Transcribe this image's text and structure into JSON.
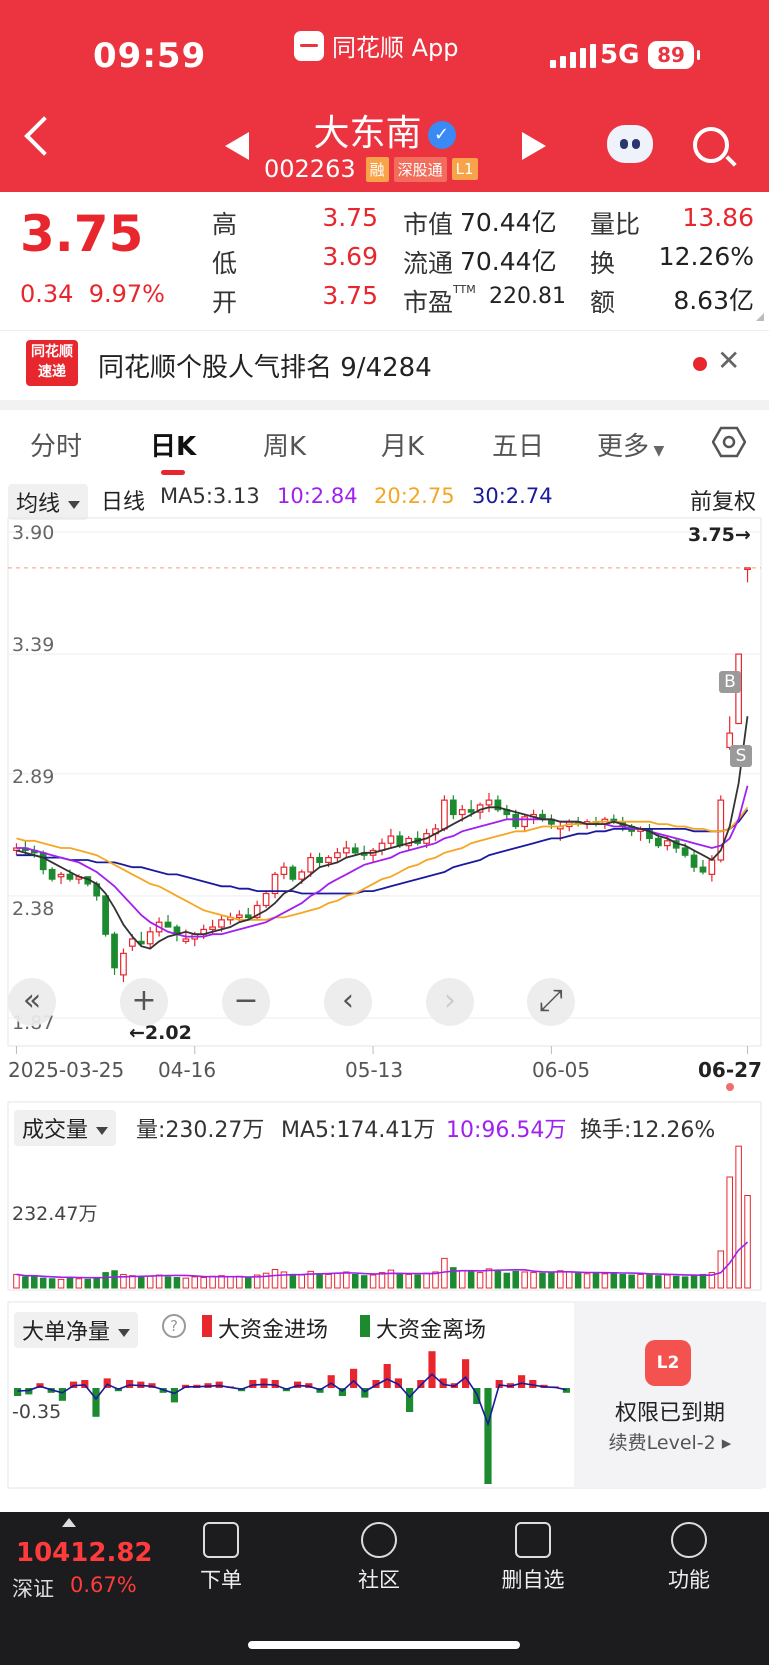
{
  "status_bar": {
    "time": "09:59",
    "app_name": "同花顺 App",
    "network": "5G",
    "battery": "89"
  },
  "stock": {
    "name": "大东南",
    "code": "002263",
    "tags": [
      "融",
      "深股通",
      "L1"
    ]
  },
  "quote": {
    "price": "3.75",
    "change": "0.34",
    "change_pct": "9.97%",
    "labels": {
      "high": "高",
      "low": "低",
      "open": "开",
      "mktcap": "市值",
      "float": "流通",
      "pe": "市盈",
      "pe_sup": "TTM",
      "vol_ratio": "量比",
      "turnover": "换",
      "amount": "额"
    },
    "values": {
      "high": "3.75",
      "low": "3.69",
      "open": "3.75",
      "mktcap": "70.44亿",
      "float": "70.44亿",
      "pe": "220.81",
      "vol_ratio": "13.86",
      "turnover": "12.26%",
      "amount": "8.63亿"
    }
  },
  "banner": {
    "logo": "同花顺\n速递",
    "text": "同花顺个股人气排名 9/4284"
  },
  "tabs": [
    "分时",
    "日K",
    "周K",
    "月K",
    "五日",
    "更多"
  ],
  "active_tab": "日K",
  "ma_row": {
    "selector": "均线",
    "period": "日线",
    "ma5": "MA5:3.13",
    "ma10": "10:2.84",
    "ma20": "20:2.75",
    "ma30": "30:2.74",
    "adjust": "前复权"
  },
  "colors": {
    "up": "#e8262e",
    "down": "#1c8a2e",
    "ma5": "#333333",
    "ma10": "#a020f0",
    "ma20": "#f5a623",
    "ma30": "#1a1a9e",
    "header": "#ec3440"
  },
  "chart_data": {
    "type": "candlestick",
    "y_ticks": [
      "3.90",
      "3.39",
      "2.89",
      "2.38",
      "1.87"
    ],
    "ylim": [
      1.87,
      3.9
    ],
    "x_ticks": [
      "2025-03-25",
      "04-16",
      "05-13",
      "06-05",
      "06-27"
    ],
    "last_price_label": "3.75→",
    "low_marker": "←2.02",
    "markers": [
      "B",
      "S"
    ],
    "candles": [
      [
        2.57,
        2.6,
        2.55,
        2.58
      ],
      [
        2.58,
        2.61,
        2.55,
        2.57
      ],
      [
        2.57,
        2.59,
        2.54,
        2.56
      ],
      [
        2.56,
        2.57,
        2.47,
        2.49
      ],
      [
        2.49,
        2.5,
        2.44,
        2.45
      ],
      [
        2.46,
        2.48,
        2.43,
        2.47
      ],
      [
        2.47,
        2.49,
        2.44,
        2.45
      ],
      [
        2.45,
        2.47,
        2.43,
        2.46
      ],
      [
        2.46,
        2.46,
        2.42,
        2.43
      ],
      [
        2.43,
        2.44,
        2.36,
        2.38
      ],
      [
        2.38,
        2.38,
        2.21,
        2.22
      ],
      [
        2.22,
        2.23,
        2.05,
        2.08
      ],
      [
        2.05,
        2.16,
        2.02,
        2.14
      ],
      [
        2.17,
        2.22,
        2.15,
        2.2
      ],
      [
        2.19,
        2.23,
        2.17,
        2.18
      ],
      [
        2.18,
        2.25,
        2.16,
        2.23
      ],
      [
        2.23,
        2.29,
        2.21,
        2.27
      ],
      [
        2.27,
        2.3,
        2.25,
        2.25
      ],
      [
        2.25,
        2.26,
        2.19,
        2.22
      ],
      [
        2.19,
        2.24,
        2.18,
        2.2
      ],
      [
        2.2,
        2.23,
        2.17,
        2.22
      ],
      [
        2.22,
        2.26,
        2.2,
        2.24
      ],
      [
        2.24,
        2.28,
        2.22,
        2.25
      ],
      [
        2.25,
        2.3,
        2.23,
        2.28
      ],
      [
        2.28,
        2.31,
        2.26,
        2.29
      ],
      [
        2.29,
        2.32,
        2.27,
        2.3
      ],
      [
        2.3,
        2.33,
        2.28,
        2.29
      ],
      [
        2.29,
        2.36,
        2.28,
        2.34
      ],
      [
        2.34,
        2.4,
        2.33,
        2.39
      ],
      [
        2.39,
        2.48,
        2.37,
        2.47
      ],
      [
        2.47,
        2.52,
        2.45,
        2.5
      ],
      [
        2.5,
        2.51,
        2.44,
        2.45
      ],
      [
        2.45,
        2.49,
        2.43,
        2.48
      ],
      [
        2.48,
        2.56,
        2.46,
        2.54
      ],
      [
        2.54,
        2.56,
        2.5,
        2.52
      ],
      [
        2.52,
        2.55,
        2.5,
        2.54
      ],
      [
        2.54,
        2.58,
        2.52,
        2.56
      ],
      [
        2.56,
        2.61,
        2.54,
        2.58
      ],
      [
        2.58,
        2.6,
        2.55,
        2.56
      ],
      [
        2.56,
        2.59,
        2.53,
        2.55
      ],
      [
        2.55,
        2.58,
        2.52,
        2.57
      ],
      [
        2.57,
        2.62,
        2.55,
        2.6
      ],
      [
        2.6,
        2.66,
        2.58,
        2.63
      ],
      [
        2.63,
        2.65,
        2.58,
        2.59
      ],
      [
        2.59,
        2.63,
        2.57,
        2.62
      ],
      [
        2.62,
        2.65,
        2.59,
        2.6
      ],
      [
        2.6,
        2.66,
        2.58,
        2.64
      ],
      [
        2.64,
        2.68,
        2.61,
        2.66
      ],
      [
        2.66,
        2.8,
        2.65,
        2.78
      ],
      [
        2.78,
        2.8,
        2.7,
        2.72
      ],
      [
        2.72,
        2.76,
        2.69,
        2.74
      ],
      [
        2.74,
        2.78,
        2.71,
        2.73
      ],
      [
        2.73,
        2.77,
        2.7,
        2.76
      ],
      [
        2.76,
        2.81,
        2.73,
        2.78
      ],
      [
        2.78,
        2.8,
        2.73,
        2.74
      ],
      [
        2.74,
        2.76,
        2.7,
        2.72
      ],
      [
        2.72,
        2.74,
        2.66,
        2.67
      ],
      [
        2.67,
        2.72,
        2.65,
        2.71
      ],
      [
        2.71,
        2.74,
        2.68,
        2.72
      ],
      [
        2.72,
        2.74,
        2.69,
        2.7
      ],
      [
        2.7,
        2.72,
        2.66,
        2.68
      ],
      [
        2.66,
        2.69,
        2.61,
        2.67
      ],
      [
        2.67,
        2.7,
        2.65,
        2.69
      ],
      [
        2.69,
        2.71,
        2.67,
        2.68
      ],
      [
        2.68,
        2.7,
        2.66,
        2.69
      ],
      [
        2.69,
        2.71,
        2.67,
        2.68
      ],
      [
        2.68,
        2.71,
        2.66,
        2.7
      ],
      [
        2.7,
        2.72,
        2.68,
        2.69
      ],
      [
        2.69,
        2.71,
        2.65,
        2.67
      ],
      [
        2.67,
        2.68,
        2.63,
        2.65
      ],
      [
        2.65,
        2.67,
        2.61,
        2.66
      ],
      [
        2.66,
        2.68,
        2.6,
        2.62
      ],
      [
        2.62,
        2.64,
        2.58,
        2.59
      ],
      [
        2.59,
        2.63,
        2.57,
        2.61
      ],
      [
        2.61,
        2.62,
        2.56,
        2.58
      ],
      [
        2.58,
        2.6,
        2.54,
        2.55
      ],
      [
        2.55,
        2.57,
        2.48,
        2.5
      ],
      [
        2.5,
        2.53,
        2.47,
        2.48
      ],
      [
        2.47,
        2.55,
        2.44,
        2.53
      ],
      [
        2.53,
        2.8,
        2.52,
        2.78
      ],
      [
        3.0,
        3.13,
        2.99,
        3.06
      ],
      [
        3.1,
        3.39,
        3.1,
        3.39
      ],
      [
        3.75,
        3.75,
        3.69,
        3.75
      ]
    ],
    "ma5": [
      2.57,
      2.56,
      2.55,
      2.54,
      2.52,
      2.5,
      2.48,
      2.46,
      2.45,
      2.43,
      2.39,
      2.33,
      2.26,
      2.21,
      2.17,
      2.16,
      2.19,
      2.21,
      2.22,
      2.23,
      2.22,
      2.22,
      2.23,
      2.24,
      2.25,
      2.27,
      2.28,
      2.3,
      2.32,
      2.35,
      2.39,
      2.41,
      2.44,
      2.47,
      2.5,
      2.51,
      2.52,
      2.54,
      2.55,
      2.56,
      2.56,
      2.57,
      2.58,
      2.59,
      2.6,
      2.61,
      2.62,
      2.64,
      2.66,
      2.68,
      2.7,
      2.72,
      2.74,
      2.75,
      2.75,
      2.74,
      2.73,
      2.72,
      2.71,
      2.7,
      2.7,
      2.69,
      2.69,
      2.69,
      2.68,
      2.68,
      2.68,
      2.69,
      2.68,
      2.67,
      2.66,
      2.65,
      2.63,
      2.62,
      2.6,
      2.59,
      2.57,
      2.55,
      2.53,
      2.57,
      2.67,
      2.85,
      3.13
    ],
    "ma10": [
      2.58,
      2.58,
      2.57,
      2.56,
      2.55,
      2.54,
      2.53,
      2.52,
      2.5,
      2.48,
      2.45,
      2.42,
      2.38,
      2.34,
      2.3,
      2.27,
      2.25,
      2.23,
      2.22,
      2.21,
      2.21,
      2.21,
      2.22,
      2.22,
      2.23,
      2.24,
      2.25,
      2.26,
      2.27,
      2.29,
      2.31,
      2.33,
      2.35,
      2.38,
      2.4,
      2.43,
      2.45,
      2.47,
      2.49,
      2.51,
      2.52,
      2.53,
      2.54,
      2.56,
      2.57,
      2.58,
      2.59,
      2.6,
      2.62,
      2.63,
      2.65,
      2.66,
      2.67,
      2.68,
      2.69,
      2.7,
      2.7,
      2.7,
      2.7,
      2.7,
      2.7,
      2.69,
      2.69,
      2.69,
      2.68,
      2.68,
      2.68,
      2.67,
      2.67,
      2.66,
      2.66,
      2.65,
      2.64,
      2.63,
      2.62,
      2.61,
      2.6,
      2.59,
      2.58,
      2.59,
      2.62,
      2.7,
      2.84
    ],
    "ma20": [
      2.62,
      2.61,
      2.61,
      2.6,
      2.59,
      2.58,
      2.58,
      2.57,
      2.56,
      2.55,
      2.53,
      2.51,
      2.49,
      2.47,
      2.45,
      2.43,
      2.42,
      2.4,
      2.38,
      2.36,
      2.34,
      2.32,
      2.31,
      2.3,
      2.29,
      2.28,
      2.28,
      2.28,
      2.28,
      2.29,
      2.29,
      2.3,
      2.31,
      2.32,
      2.33,
      2.35,
      2.36,
      2.38,
      2.39,
      2.41,
      2.43,
      2.45,
      2.46,
      2.48,
      2.5,
      2.51,
      2.53,
      2.54,
      2.56,
      2.57,
      2.58,
      2.6,
      2.61,
      2.62,
      2.63,
      2.64,
      2.65,
      2.65,
      2.66,
      2.67,
      2.67,
      2.67,
      2.68,
      2.68,
      2.68,
      2.69,
      2.69,
      2.69,
      2.69,
      2.69,
      2.69,
      2.69,
      2.68,
      2.68,
      2.67,
      2.67,
      2.66,
      2.66,
      2.65,
      2.65,
      2.66,
      2.7,
      2.75
    ],
    "ma30": [
      2.55,
      2.55,
      2.55,
      2.54,
      2.54,
      2.54,
      2.53,
      2.53,
      2.53,
      2.52,
      2.52,
      2.52,
      2.51,
      2.5,
      2.5,
      2.49,
      2.48,
      2.47,
      2.47,
      2.46,
      2.45,
      2.44,
      2.43,
      2.42,
      2.42,
      2.41,
      2.41,
      2.4,
      2.4,
      2.4,
      2.4,
      2.4,
      2.39,
      2.39,
      2.39,
      2.39,
      2.39,
      2.39,
      2.39,
      2.4,
      2.4,
      2.41,
      2.42,
      2.43,
      2.44,
      2.45,
      2.46,
      2.47,
      2.48,
      2.5,
      2.51,
      2.52,
      2.53,
      2.55,
      2.56,
      2.57,
      2.58,
      2.59,
      2.6,
      2.61,
      2.62,
      2.62,
      2.63,
      2.64,
      2.64,
      2.65,
      2.65,
      2.66,
      2.66,
      2.66,
      2.66,
      2.66,
      2.66,
      2.66,
      2.66,
      2.66,
      2.65,
      2.65,
      2.65,
      2.65,
      2.66,
      2.69,
      2.74
    ]
  },
  "chart_controls": [
    "«",
    "+",
    "−",
    "‹",
    "›",
    "⤢"
  ],
  "volume": {
    "selector": "成交量",
    "vol": "量:230.27万",
    "ma5": "MA5:174.41万",
    "ma10": "10:96.54万",
    "turnover": "换手:12.26%",
    "ref": "232.47万",
    "values": [
      22,
      18,
      20,
      16,
      15,
      14,
      16,
      15,
      14,
      17,
      25,
      28,
      22,
      20,
      18,
      19,
      21,
      18,
      17,
      16,
      18,
      17,
      19,
      20,
      18,
      19,
      17,
      21,
      24,
      30,
      26,
      22,
      21,
      27,
      23,
      22,
      24,
      26,
      22,
      20,
      21,
      25,
      29,
      24,
      22,
      21,
      24,
      26,
      48,
      33,
      28,
      26,
      25,
      31,
      27,
      24,
      27,
      26,
      25,
      24,
      25,
      28,
      26,
      24,
      23,
      24,
      23,
      25,
      22,
      21,
      22,
      21,
      20,
      21,
      19,
      18,
      20,
      22,
      25,
      60,
      180,
      230,
      150
    ]
  },
  "fund_flow": {
    "selector": "大单净量",
    "legend_in": "大资金进场",
    "legend_out": "大资金离场",
    "ref": "-0.35",
    "values": [
      -0.05,
      -0.04,
      0.03,
      -0.03,
      -0.08,
      0.04,
      0.05,
      -0.18,
      0.06,
      -0.02,
      0.05,
      0.04,
      0.03,
      -0.03,
      -0.09,
      0.02,
      0.02,
      0.03,
      0.04,
      0.01,
      -0.02,
      0.05,
      0.06,
      0.05,
      -0.02,
      0.04,
      0.03,
      -0.03,
      0.08,
      -0.05,
      0.12,
      -0.06,
      0.05,
      0.15,
      0.06,
      -0.15,
      0.05,
      0.23,
      0.06,
      0.03,
      0.18,
      -0.1,
      -0.6,
      0.05,
      0.03,
      0.08,
      0.05,
      0.02,
      0.01,
      -0.03
    ]
  },
  "paywall": {
    "icon": "L2",
    "title": "权限已到期",
    "link": "续费Level-2 ▸"
  },
  "index": {
    "value": "10412.82",
    "name": "深证",
    "pct": "0.67%"
  },
  "bottom_nav": [
    "下单",
    "社区",
    "删自选",
    "功能"
  ]
}
